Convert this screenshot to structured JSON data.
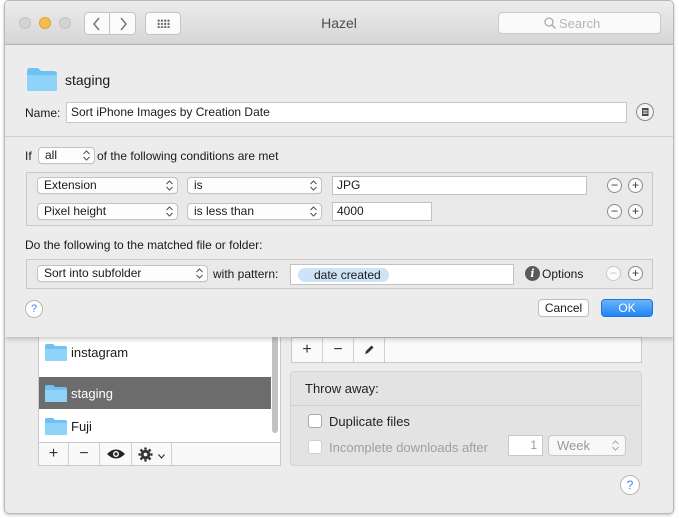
{
  "window": {
    "title": "Hazel",
    "search_placeholder": "Search"
  },
  "sidebar": {
    "folders": [
      {
        "name": "instagram",
        "selected": false
      },
      {
        "name": "staging",
        "selected": true
      },
      {
        "name": "Fuji",
        "selected": false
      }
    ],
    "toolbar": {
      "add": "+",
      "remove": "−",
      "view": "eye-icon",
      "gear": "gear-icon"
    }
  },
  "rules_toolbar": {
    "add": "+",
    "remove": "−",
    "edit": "pencil-icon"
  },
  "throw_away": {
    "title": "Throw away:",
    "duplicate_label": "Duplicate files",
    "duplicate_checked": false,
    "incomplete_label": "Incomplete downloads after",
    "incomplete_checked": false,
    "incomplete_enabled": false,
    "incomplete_amount": "1",
    "incomplete_unit": "Week"
  },
  "sheet": {
    "folder_name": "staging",
    "name_label": "Name:",
    "rule_name": "Sort iPhone Images by Creation Date",
    "if_label": "If",
    "match_mode": "all",
    "conditions_suffix": "of the following conditions are met",
    "conditions": [
      {
        "attribute": "Extension",
        "operator": "is",
        "value": "JPG"
      },
      {
        "attribute": "Pixel height",
        "operator": "is less than",
        "value": "4000"
      }
    ],
    "actions_label": "Do the following to the matched file or folder:",
    "action": {
      "type": "Sort into subfolder",
      "with_label": "with pattern:",
      "pattern_token": "date created",
      "options_label": "Options"
    },
    "cancel_label": "Cancel",
    "ok_label": "OK",
    "help": "?"
  },
  "colors": {
    "accent": "#1f85f5",
    "folder": "#6ec2f3",
    "token": "#cde3f7",
    "selection": "#6c6c6c"
  }
}
